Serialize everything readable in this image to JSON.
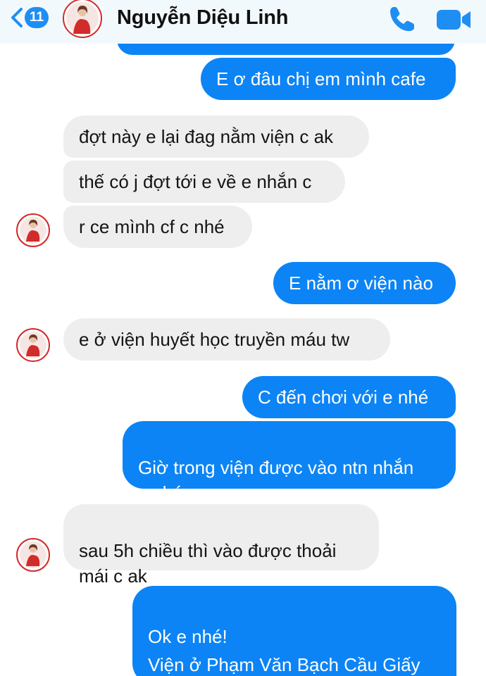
{
  "header": {
    "back_count": "11",
    "contact_name": "Nguyễn Diệu Linh",
    "icons": [
      "chevron-left-icon",
      "phone-icon",
      "video-camera-icon"
    ]
  },
  "colors": {
    "accent": "#0c84f5",
    "badge": "#1e8ef3",
    "received_bubble": "#eeeeee",
    "header_bg": "#f2f9fd"
  },
  "messages": [
    {
      "from": "me",
      "text": ""
    },
    {
      "from": "me",
      "text": "E ơ đâu chị em mình cafe"
    },
    {
      "from": "contact",
      "text": "đợt này e lại đag nằm viện c ak"
    },
    {
      "from": "contact",
      "text": "thế có j đợt tới e về e nhắn c"
    },
    {
      "from": "contact",
      "text": "r ce mình cf c nhé"
    },
    {
      "from": "me",
      "text": "E nằm ơ viện nào"
    },
    {
      "from": "contact",
      "text": "e ở viện huyết học truyền máu tw"
    },
    {
      "from": "me",
      "text": "C đến chơi với e nhé"
    },
    {
      "from": "me",
      "text": "Giờ trong viện được vào ntn nhắn\nc nhé"
    },
    {
      "from": "contact",
      "text": "sau 5h chiều thì vào được thoải\nmái  c ak"
    },
    {
      "from": "me",
      "text": "Ok e nhé!\nViện ở Phạm Văn Bạch Cầu Giấy\ne nhi"
    }
  ]
}
